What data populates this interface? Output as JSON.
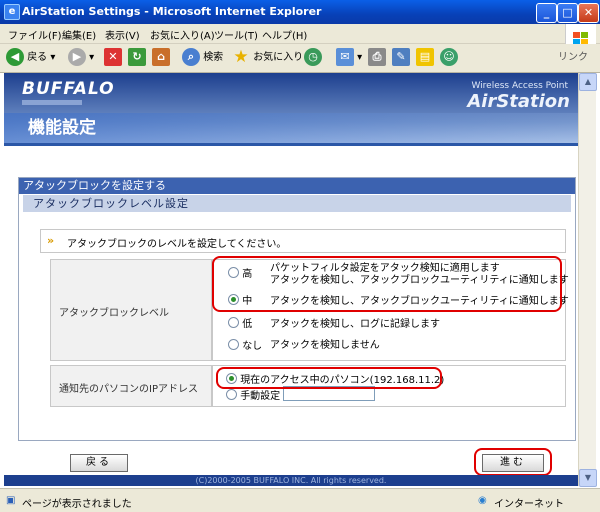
{
  "window": {
    "title": "AirStation Settings - Microsoft Internet Explorer"
  },
  "menu": [
    "ファイル(F)",
    "編集(E)",
    "表示(V)",
    "お気に入り(A)",
    "ツール(T)",
    "ヘルプ(H)"
  ],
  "toolbar": {
    "back": "戻る",
    "search": "検索",
    "favorites": "お気に入り",
    "links": "リンク"
  },
  "header": {
    "brand": "BUFFALO",
    "product_tag": "Wireless Access Point",
    "product": "AirStation",
    "page_title": "機能設定"
  },
  "section": {
    "title": "アタックブロックを設定する",
    "subtitle": "アタックブロックレベル設定"
  },
  "note": "アタックブロックのレベルを設定してください。",
  "level": {
    "label": "アタックブロックレベル",
    "options": [
      {
        "name": "高",
        "desc1": "パケットフィルタ設定をアタック検知に適用します",
        "desc2": "アタックを検知し、アタックブロックユーティリティに通知します",
        "selected": false
      },
      {
        "name": "中",
        "desc1": "アタックを検知し、アタックブロックユーティリティに通知します",
        "selected": true
      },
      {
        "name": "低",
        "desc1": "アタックを検知し、ログに記録します",
        "selected": false
      },
      {
        "name": "なし",
        "desc1": "アタックを検知しません",
        "selected": false
      }
    ]
  },
  "notify": {
    "label": "通知先のパソコンのIPアドレス",
    "current": "現在のアクセス中のパソコン(192.168.11.2)",
    "manual": "手動設定",
    "manual_value": ""
  },
  "buttons": {
    "back": "戻る",
    "next": "進む"
  },
  "footer": "(C)2000-2005 BUFFALO INC. All rights reserved.",
  "status": {
    "text": "ページが表示されました",
    "zone": "インターネット"
  }
}
